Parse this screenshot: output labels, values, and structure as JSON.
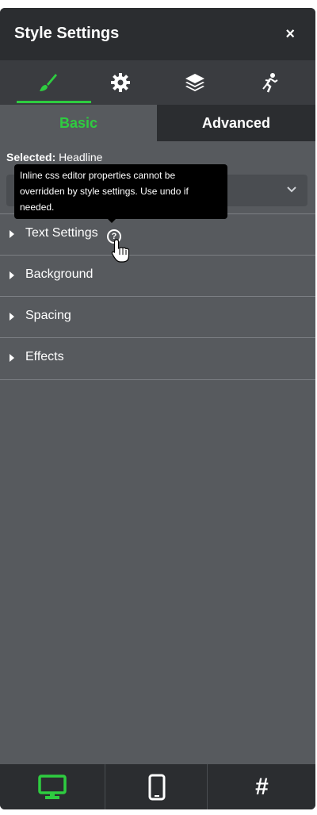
{
  "header": {
    "title": "Style Settings",
    "close_label": "×"
  },
  "icon_tabs": [
    {
      "icon": "brush-icon",
      "active": true
    },
    {
      "icon": "gear-icon",
      "active": false
    },
    {
      "icon": "layers-icon",
      "active": false
    },
    {
      "icon": "running-figure-icon",
      "active": false
    }
  ],
  "sub_tabs": {
    "basic": "Basic",
    "advanced": "Advanced"
  },
  "selected": {
    "label": "Selected:",
    "value": "Headline"
  },
  "tooltip": {
    "text": "Inline css editor properties cannot be overridden by style settings. Use undo if needed."
  },
  "sections": [
    {
      "label": "Text Settings"
    },
    {
      "label": "Background"
    },
    {
      "label": "Spacing"
    },
    {
      "label": "Effects"
    }
  ],
  "bottom_tabs": [
    {
      "icon": "desktop-icon",
      "active": true
    },
    {
      "icon": "mobile-icon",
      "active": false
    },
    {
      "icon": "hash-icon",
      "text": "#",
      "active": false
    }
  ],
  "colors": {
    "accent": "#2ecc40",
    "panel": "#575a5e",
    "dark": "#2b2d30"
  }
}
